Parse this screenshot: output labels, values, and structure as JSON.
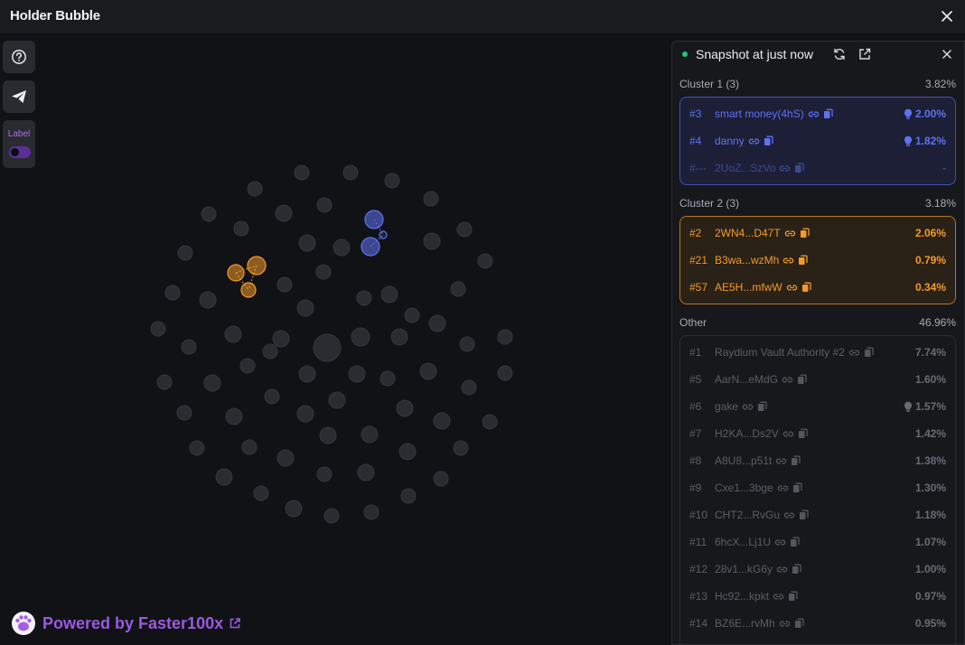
{
  "app": {
    "title": "Holder Bubble"
  },
  "sidebar": {
    "help_icon": "question-circle-icon",
    "telegram_icon": "telegram-send-icon",
    "label_toggle": {
      "label": "Label",
      "on": true
    }
  },
  "footer": {
    "powered_by": "Powered by Faster100x",
    "logo_icon": "paw-icon",
    "link_icon": "external-link-icon"
  },
  "panel": {
    "title": "Snapshot at just now",
    "status_color": "#26c281",
    "clusters": [
      {
        "name": "Cluster 1 (3)",
        "percent": "3.82%",
        "color": "#5f72f2",
        "rows": [
          {
            "rank": "#3",
            "name": "smart money(4hS)",
            "value": "2.00%",
            "bulb": true
          },
          {
            "rank": "#4",
            "name": "danny",
            "value": "1.82%",
            "bulb": true
          },
          {
            "rank": "#---",
            "name": "2UoZ...SzVo",
            "value": "-",
            "bulb": false
          }
        ]
      },
      {
        "name": "Cluster 2 (3)",
        "percent": "3.18%",
        "color": "#f39a2b",
        "rows": [
          {
            "rank": "#2",
            "name": "2WN4...D47T",
            "value": "2.06%",
            "bulb": false
          },
          {
            "rank": "#21",
            "name": "B3wa...wzMh",
            "value": "0.79%",
            "bulb": false
          },
          {
            "rank": "#57",
            "name": "AE5H...mfwW",
            "value": "0.34%",
            "bulb": false
          }
        ]
      }
    ],
    "other": {
      "name": "Other",
      "percent": "46.96%",
      "rows": [
        {
          "rank": "#1",
          "name": "Raydium Vault Authority #2",
          "value": "7.74%",
          "bulb": false
        },
        {
          "rank": "#5",
          "name": "AarN...eMdG",
          "value": "1.60%",
          "bulb": false
        },
        {
          "rank": "#6",
          "name": "gake",
          "value": "1.57%",
          "bulb": true
        },
        {
          "rank": "#7",
          "name": "H2KA...Ds2V",
          "value": "1.42%",
          "bulb": false
        },
        {
          "rank": "#8",
          "name": "A8U8...p51t",
          "value": "1.38%",
          "bulb": false
        },
        {
          "rank": "#9",
          "name": "Cxe1...3bge",
          "value": "1.30%",
          "bulb": false
        },
        {
          "rank": "#10",
          "name": "CHT2...RvGu",
          "value": "1.18%",
          "bulb": false
        },
        {
          "rank": "#11",
          "name": "6hcX...Lj1U",
          "value": "1.07%",
          "bulb": false
        },
        {
          "rank": "#12",
          "name": "28v1...kG6y",
          "value": "1.00%",
          "bulb": false
        },
        {
          "rank": "#13",
          "name": "Hc92...kpkt",
          "value": "0.97%",
          "bulb": false
        },
        {
          "rank": "#14",
          "name": "BZ6E...rvMh",
          "value": "0.95%",
          "bulb": false
        }
      ]
    }
  },
  "colors": {
    "cluster1": "#5f72f2",
    "cluster2": "#f39a2b",
    "neutral_bubble": "#2b2c32",
    "accent": "#9b59e0"
  }
}
